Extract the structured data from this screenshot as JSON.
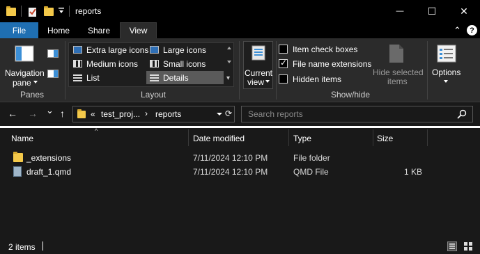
{
  "window": {
    "title": "reports",
    "minimize_icon": "minimize-icon",
    "maximize_icon": "maximize-icon",
    "close_icon": "close-icon",
    "min_glyph": "—",
    "max_glyph": "☐",
    "close_glyph": "✕"
  },
  "ribbon_tabs": {
    "file": "File",
    "home": "Home",
    "share": "Share",
    "view": "View",
    "collapse_glyph": "⌃",
    "help_glyph": "?"
  },
  "ribbon": {
    "panes": {
      "nav_pane_line1": "Navigation",
      "nav_pane_line2": "pane",
      "label": "Panes"
    },
    "layout": {
      "extra_large": "Extra large icons",
      "large": "Large icons",
      "medium": "Medium icons",
      "small": "Small icons",
      "list": "List",
      "details": "Details",
      "label": "Layout"
    },
    "current_view": {
      "line1": "Current",
      "line2": "view"
    },
    "show_hide": {
      "item_check_boxes": "Item check boxes",
      "item_check_boxes_checked": false,
      "file_name_extensions": "File name extensions",
      "file_name_extensions_checked": true,
      "hidden_items": "Hidden items",
      "hidden_items_checked": false,
      "hide_selected_line1": "Hide selected",
      "hide_selected_line2": "items",
      "label": "Show/hide"
    },
    "options": {
      "label": "Options"
    }
  },
  "navigation": {
    "back_glyph": "←",
    "forward_glyph": "→",
    "recent_glyph": "⌄",
    "up_glyph": "↑",
    "breadcrumb_overflow": "«",
    "crumb1": "test_proj...",
    "crumb_sep": "›",
    "crumb2": "reports",
    "search_placeholder": "Search reports"
  },
  "columns": {
    "name": "Name",
    "date_modified": "Date modified",
    "type": "Type",
    "size": "Size"
  },
  "files": [
    {
      "name": "_extensions",
      "date": "7/11/2024 12:10 PM",
      "type": "File folder",
      "size": ""
    },
    {
      "name": "draft_1.qmd",
      "date": "7/11/2024 12:10 PM",
      "type": "QMD File",
      "size": "1 KB"
    }
  ],
  "status": {
    "item_count": "2 items"
  },
  "colors": {
    "file_tab": "#1f6fb2",
    "folder": "#f4c94a",
    "background": "#191919",
    "ribbon": "#2b2b2b"
  }
}
